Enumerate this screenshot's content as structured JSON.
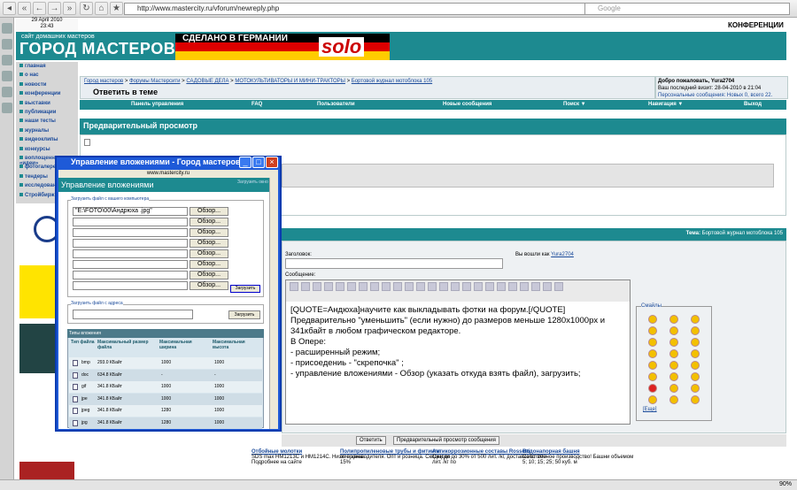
{
  "browser": {
    "url": "http://www.mastercity.ru/vforum/newreply.php",
    "search_placeholder": "Google",
    "zoom": "90%"
  },
  "site": {
    "date": "29 April 2010",
    "time": "23:43",
    "conferences": "КОНФЕРЕНЦИИ",
    "logo_small": "сайт домашних мастеров",
    "logo_big": "ГОРОД МАСТЕРОВ",
    "ad_text": "СДЕЛАНО В ГЕРМАНИИ",
    "ad_brand": "solo"
  },
  "left_nav": [
    "главная",
    "о нас",
    "новости",
    "конференции",
    "выставки",
    "публикации",
    "наши тесты",
    "журналы",
    "видеоклипы",
    "конкурсы",
    "воплощенные «идеи»",
    "фотогалерея",
    "тендеры",
    "исследования",
    "Стройбирж"
  ],
  "breadcrumb": {
    "items": [
      "Город мастеров",
      "Форумы Мастерсити",
      "САДОВЫЕ ДЕЛА",
      "МОТОКУЛЬТИВАТОРЫ И МИНИ-ТРАКТОРЫ",
      "Бортовой журнал мотоблока 105"
    ],
    "title": "Ответить в теме"
  },
  "welcome": {
    "line1": "Добро пожаловать, Yura2704",
    "line2": "Ваш последний визит: 28-04-2010 в 21:04",
    "line3": "Персональные сообщения: Новых 0, всего 22."
  },
  "menu": [
    "Панель управления",
    "FAQ",
    "Пользователи",
    "Новые сообщения",
    "Поиск ▼",
    "Навигация ▼",
    "Выход"
  ],
  "preview": {
    "title": "Предварительный просмотр"
  },
  "reply": {
    "theme_label": "Тема:",
    "theme": "Бортовой журнал мотоблока 105",
    "subject_label": "Заголовок:",
    "logged_as_label": "Вы вошли как",
    "user": "Yura2704",
    "message_label": "Сообщение:",
    "message": "[QUOTE=Андюха]научите как выкладывать фотки на форум.[/QUOTE]\nПредварительно \"уменьшить\" (если нужно) до размеров меньше 1280х1000px и 341кбайт в любом графическом редакторе.\nВ Опере:\n- расширенный режим;\n- присоедениь - \"скрепочка\" ;\n- управление вложениями - Обзор (указать откуда взять файл), загрузить;",
    "smilies_label": "Смайлы",
    "more_smilies": "[Еще]",
    "btn_reply": "Ответить",
    "btn_preview": "Предварительный просмотр сообщения"
  },
  "bottom_ads": [
    {
      "title": "Отбойные молотки",
      "text": "SDS max HM1213C и HM1214C. Низкие цены. Подробнее на сайте"
    },
    {
      "title": "Полипропиленовые трубы и фитинги",
      "text": "от производителя. Опт и розница. Скидки до 15%"
    },
    {
      "title": "Антикоррозионные составы Rossetti",
      "text": "Скидки до 30% от 500 лит. /кг, доставка от 200 лит. /кг по"
    },
    {
      "title": "Водонапорная башня",
      "text": "Собственное производство! Башни объемом 5; 10; 15; 25; 50 куб. м"
    }
  ],
  "popup": {
    "title": "Управление вложениями - Город мастеров",
    "url": "www.mastercity.ru",
    "header": "Управление вложениями",
    "upload_link": "Загрузить окно",
    "upload_label": "Загрузить файл с вашего компьютера",
    "file1": "\"E:\\FOTO\\00\\Андрюха .jpg\"",
    "browse": "Обзор...",
    "upload_btn": "Загрузить",
    "url_label": "Загрузить файл с адреса",
    "url_btn": "Загрузить",
    "table_title": "Типы вложения",
    "col1": "Тип файла",
    "col2": "Максимальный размер файла",
    "col3": "Максимальная ширина",
    "col4": "Максимальная высота",
    "rows": [
      [
        "bmp",
        "293.0 КБайт",
        "1000",
        "1000"
      ],
      [
        "doc",
        "634.8 КБайт",
        "-",
        "-"
      ],
      [
        "gif",
        "341.8 КБайт",
        "1000",
        "1000"
      ],
      [
        "jpe",
        "341.8 КБайт",
        "1000",
        "1000"
      ],
      [
        "jpeg",
        "341.8 КБайт",
        "1280",
        "1000"
      ],
      [
        "jpg",
        "341.8 КБайт",
        "1280",
        "1000"
      ]
    ]
  }
}
